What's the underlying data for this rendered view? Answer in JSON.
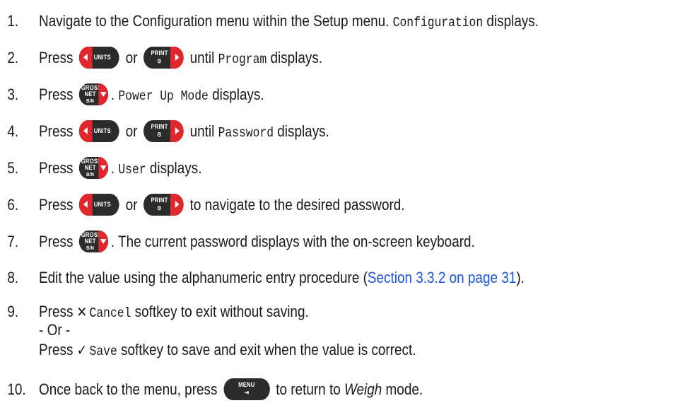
{
  "steps": [
    {
      "num": "1.",
      "pre": "Navigate to the Configuration menu within the Setup menu. ",
      "mono": "Configuration",
      "post": " displays."
    },
    {
      "num": "2.",
      "press": "Press",
      "or": "or",
      "until": "until",
      "mono": "Program",
      "post": " displays."
    },
    {
      "num": "3.",
      "press": "Press",
      "dot": ". ",
      "mono": "Power Up Mode",
      "post": " displays."
    },
    {
      "num": "4.",
      "press": "Press",
      "or": "or",
      "until": "until",
      "mono": "Password",
      "post": " displays."
    },
    {
      "num": "5.",
      "press": "Press",
      "dot": ". ",
      "mono": "User",
      "post": " displays."
    },
    {
      "num": "6.",
      "press": "Press",
      "or": "or",
      "post": "to navigate to the desired password."
    },
    {
      "num": "7.",
      "press": "Press",
      "post": ". The current password displays with the on-screen keyboard."
    },
    {
      "num": "8.",
      "pre": "Edit the value using the alphanumeric entry procedure (",
      "link": "Section 3.3.2 on page 31",
      "post": ")."
    },
    {
      "num": "9.",
      "press": "Press",
      "cancel_key": "Cancel",
      "cancel_post": " softkey to exit without saving.",
      "or_line": "- Or -",
      "save_key": "Save",
      "save_post": " softkey to save and exit when the value is correct."
    },
    {
      "num": "10.",
      "pre": "Once back to the menu, press",
      "post_a": "to return to ",
      "italic": "Weigh",
      "post_b": " mode."
    }
  ],
  "buttons": {
    "units": "UNITS",
    "print_top": "PRINT",
    "print_bottom": "⊙",
    "gross_top": "GROSS",
    "gross_mid": "NET",
    "gross_bot": "B/N",
    "menu_top": "MENU",
    "menu_bottom": "⇥"
  },
  "icons": {
    "cancel": "✕",
    "save": "✓"
  },
  "colors": {
    "accent_red": "#e0272e",
    "button_dark": "#2b2b2b",
    "link_blue": "#1a55e0"
  }
}
